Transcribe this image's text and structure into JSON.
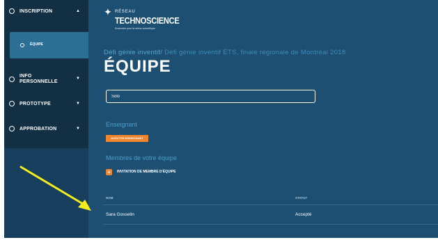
{
  "sidebar": {
    "items": [
      {
        "label": "INSCRIPTION",
        "arrow": "▲"
      },
      {
        "label": "ÉQUIPE"
      },
      {
        "label": "INFO PERSONNELLE",
        "line1": "INFO",
        "line2": "PERSONNELLE",
        "arrow": "▼"
      },
      {
        "label": "PROTOTYPE",
        "arrow": "▼"
      },
      {
        "label": "APPROBATION",
        "arrow": "▼"
      }
    ]
  },
  "logo": {
    "network": "RÉSEAU",
    "name": "TECHNOSCIENCE",
    "tagline": "Ensemble pour la relève scientifique"
  },
  "breadcrumb": {
    "first": "Défi génie inventif/",
    "second": "Défi génie inventif ÉTS, finale régionale de Montréal 2018"
  },
  "page_title": "ÉQUIPE",
  "team_name_input": {
    "value": "Solo"
  },
  "teacher_section": {
    "title": "Enseignant",
    "add_button": "AJOUTER ENSEIGNANT"
  },
  "members_section": {
    "title": "Membres de votre équipe",
    "invite_label": "INVITATION DE MEMBRE D'ÉQUIPE"
  },
  "members_table": {
    "columns": [
      "NOM",
      "STATUT"
    ],
    "rows": [
      {
        "name": "Sara Gosselin",
        "status": "Accepté"
      }
    ]
  },
  "colors": {
    "background": "#1c4f72",
    "sidebar": "#132f44",
    "accent": "#f0852d",
    "annotation_arrow": "#f4ef1c"
  }
}
